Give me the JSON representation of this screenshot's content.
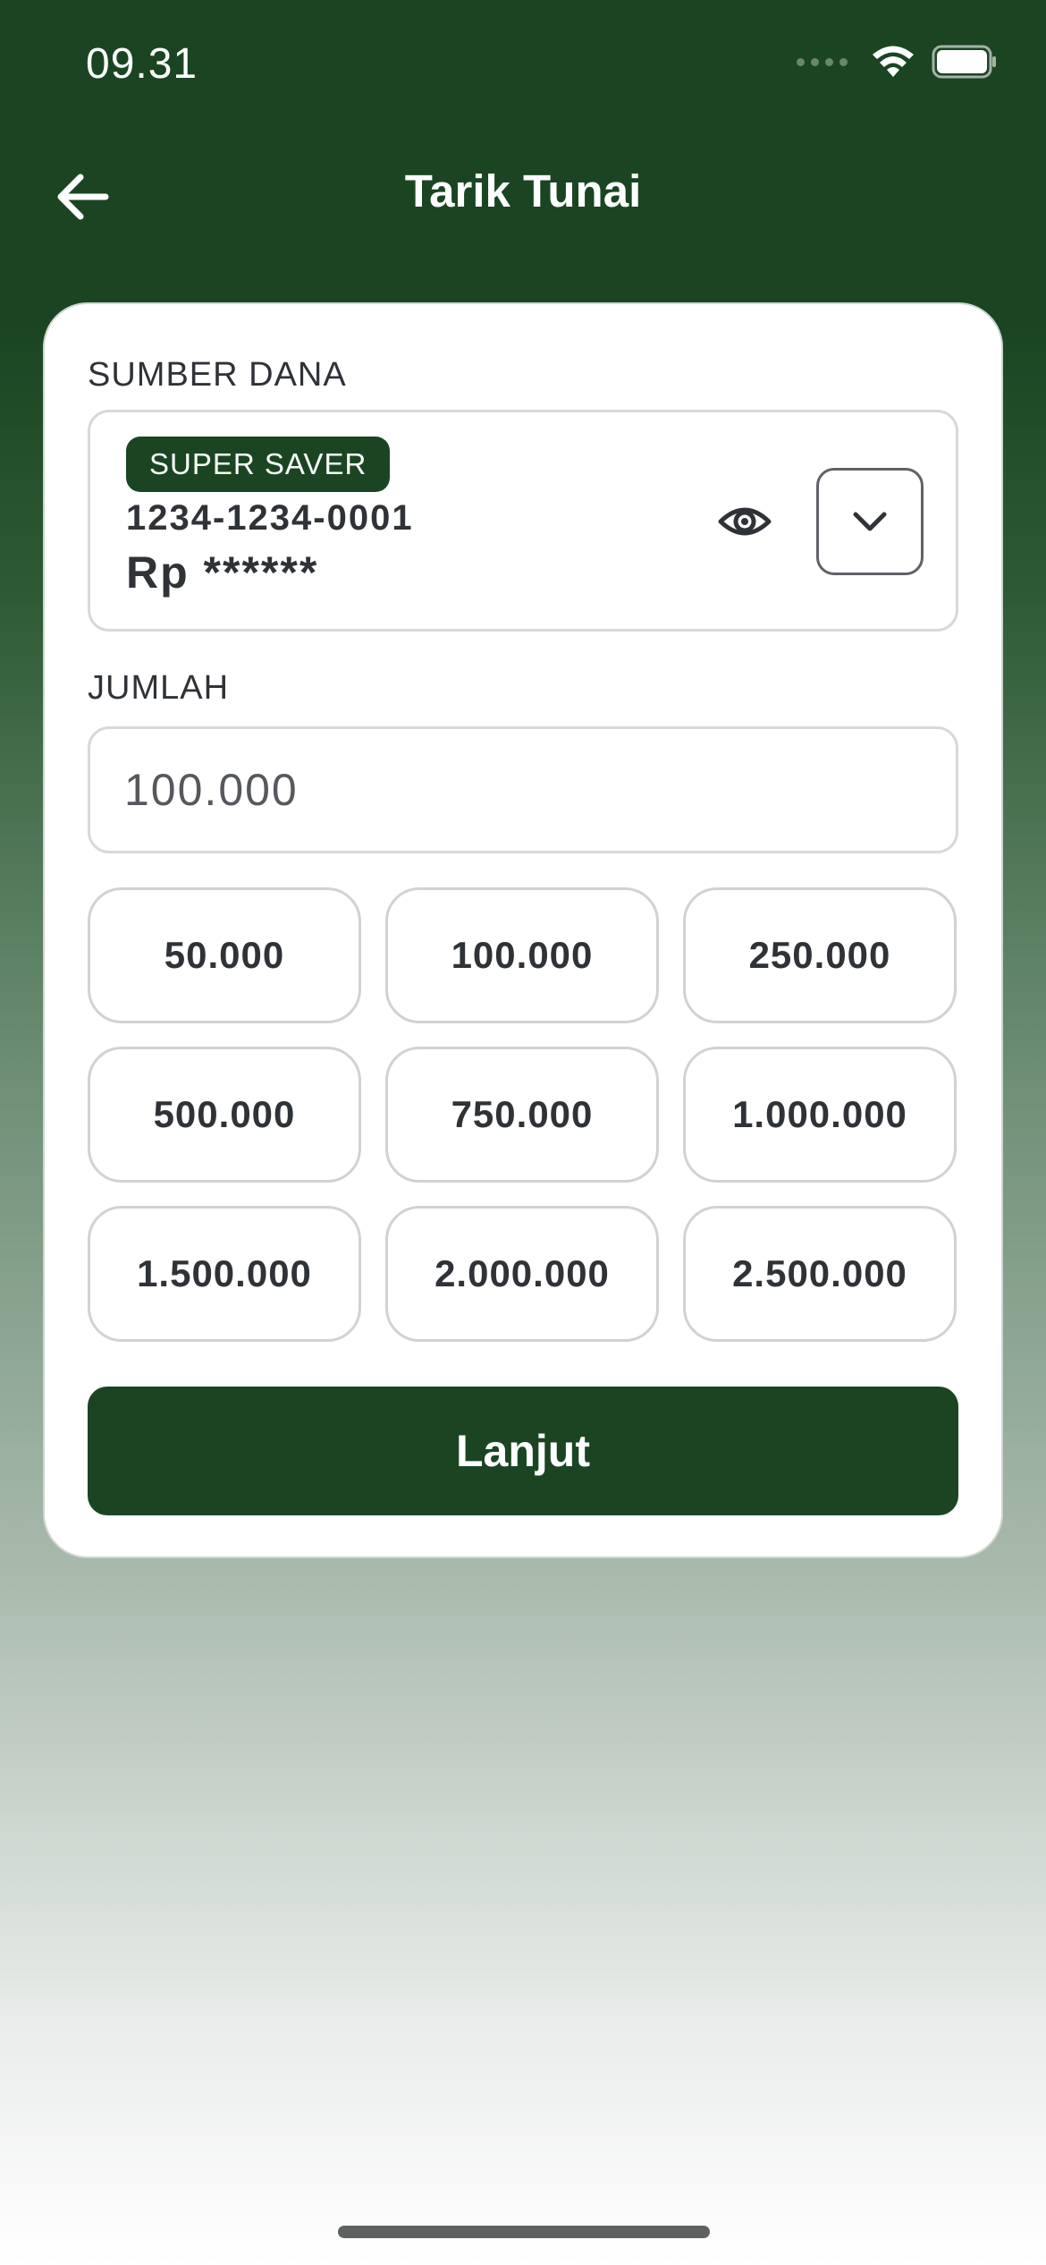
{
  "status_bar": {
    "time": "09.31",
    "icons": [
      "signal-icon",
      "wifi-icon",
      "battery-icon"
    ]
  },
  "header": {
    "title": "Tarik Tunai",
    "back_icon": "arrow-left-icon"
  },
  "colors": {
    "primary": "#1b4522",
    "text": "#2f3338",
    "border": "#d8d8d8"
  },
  "source": {
    "label": "SUMBER DANA",
    "account": {
      "type_badge": "SUPER SAVER",
      "number": "1234-1234-0001",
      "balance": "Rp ******"
    },
    "toggle_visibility_icon": "eye-icon",
    "dropdown_icon": "chevron-down-icon"
  },
  "amount": {
    "label": "JUMLAH",
    "value": "100.000",
    "presets": [
      "50.000",
      "100.000",
      "250.000",
      "500.000",
      "750.000",
      "1.000.000",
      "1.500.000",
      "2.000.000",
      "2.500.000"
    ]
  },
  "actions": {
    "next_label": "Lanjut"
  }
}
